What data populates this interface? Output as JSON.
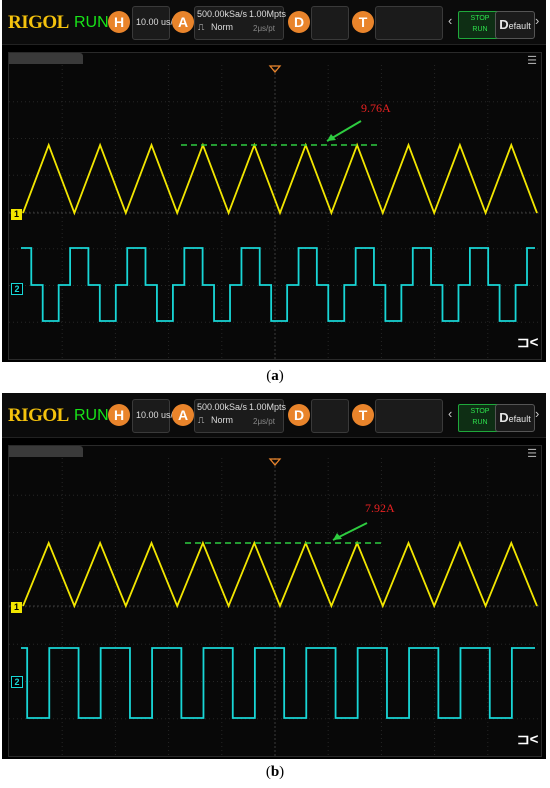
{
  "panels": [
    {
      "id": "a",
      "brand": "RIGOL",
      "run_state": "RUN",
      "horizontal_btn": "H",
      "timebase": "10.00 us/",
      "acquire_btn": "A",
      "sample_rate": "500.00kSa/s",
      "memory_depth": "1.00Mpts",
      "trigger_mode": "Norm",
      "time_per_point": "2μs/pt",
      "decode_btn": "D",
      "trigger_btn": "T",
      "stop_label": "STOP",
      "run_label": "RUN",
      "default_label": "efault",
      "default_initial": "D",
      "ch1_label": "1",
      "ch2_label": "2",
      "annotation": "9.76A",
      "caption_open": "(",
      "caption_letter": "a",
      "caption_close": ")",
      "ch1_periods": 10,
      "ch2_periods": 9
    },
    {
      "id": "b",
      "brand": "RIGOL",
      "run_state": "RUN",
      "horizontal_btn": "H",
      "timebase": "10.00 us/",
      "acquire_btn": "A",
      "sample_rate": "500.00kSa/s",
      "memory_depth": "1.00Mpts",
      "trigger_mode": "Norm",
      "time_per_point": "2μs/pt",
      "decode_btn": "D",
      "trigger_btn": "T",
      "stop_label": "STOP",
      "run_label": "RUN",
      "default_label": "efault",
      "default_initial": "D",
      "ch1_label": "1",
      "ch2_label": "2",
      "annotation": "7.92A",
      "caption_open": "(",
      "caption_letter": "b",
      "caption_close": ")",
      "ch1_periods": 10,
      "ch2_periods": 10
    }
  ],
  "colors": {
    "ch1": "#f2e600",
    "ch2": "#18d6d6",
    "marker": "#2ecc40",
    "trigger": "#e9842b",
    "annotation": "#e82222"
  },
  "icons": {
    "menu": "hamburger-icon",
    "exit": "exit-icon",
    "trigger_marker": "trigger-position-icon"
  }
}
